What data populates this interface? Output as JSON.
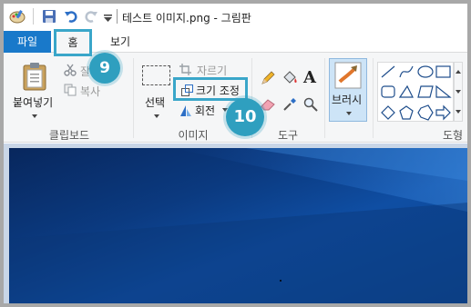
{
  "titlebar": {
    "title": "테스트 이미지.png - 그림판"
  },
  "tabs": {
    "file": "파일",
    "home": "홈",
    "view": "보기"
  },
  "clipboard": {
    "paste": "붙여넣기",
    "cut": "잘",
    "copy": "복사",
    "group_label": "클립보드"
  },
  "image": {
    "select": "선택",
    "crop": "자르기",
    "resize": "크기 조정",
    "rotate": "회전",
    "group_label": "이미지"
  },
  "tools": {
    "group_label": "도구",
    "text_tool": "A"
  },
  "brushes": {
    "label": "브러시"
  },
  "shapes": {
    "group_label": "도형"
  },
  "annotations": {
    "badge_9": "9",
    "badge_10": "10"
  },
  "colors": {
    "file_tab": "#1979ca",
    "highlight": "#3aa6c9",
    "badge": "#2f9fbf",
    "canvas": "#0b3a80"
  }
}
